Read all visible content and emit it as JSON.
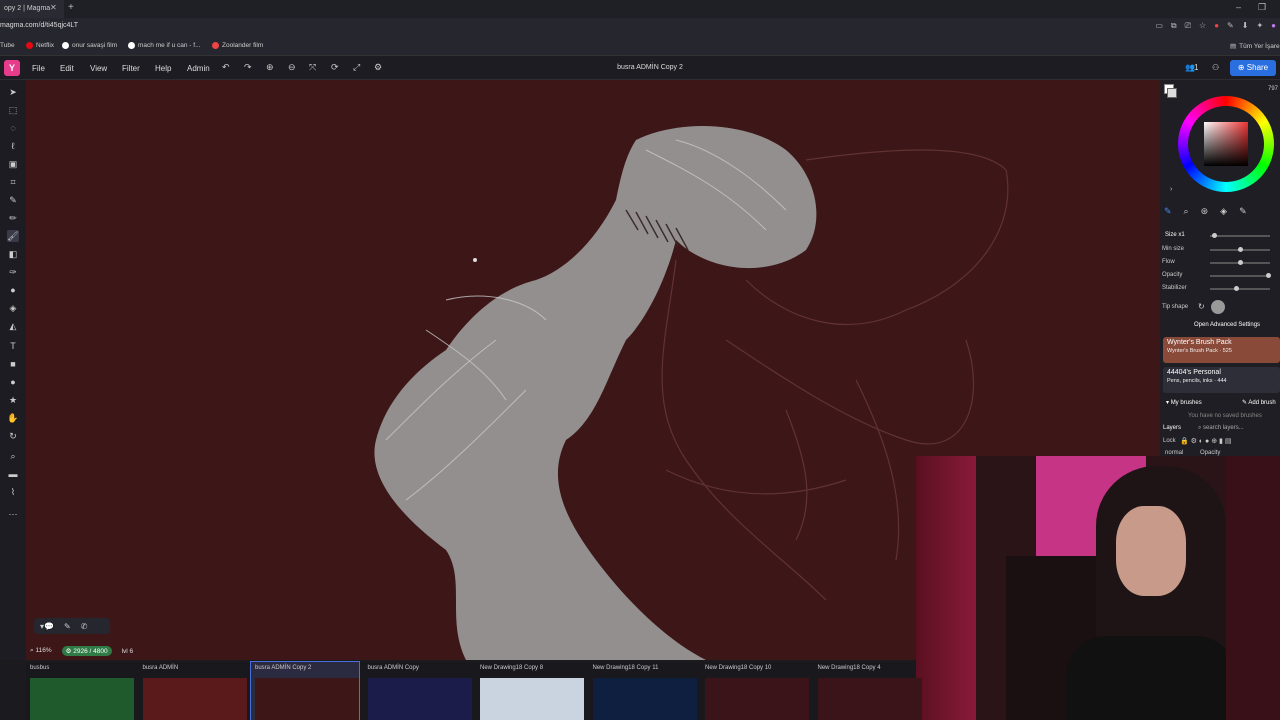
{
  "browser": {
    "tab_title": "opy 2 | Magma",
    "url": "magma.com/d/ti45qjc4LT",
    "bookmarks": [
      {
        "label": "Tube"
      },
      {
        "label": "Netflix"
      },
      {
        "label": "onur savaşi film"
      },
      {
        "label": "mach me if u can - f..."
      },
      {
        "label": "Zoolander film"
      }
    ],
    "all_bookmarks": "Tüm Yer İşare"
  },
  "app": {
    "logo": "Y",
    "menu": [
      "File",
      "Edit",
      "View",
      "Filter",
      "Help",
      "Admin"
    ],
    "document_title": "busra ADMİN Copy 2",
    "collaborators": "1",
    "share_label": "Share"
  },
  "right_panel": {
    "size_label": "Size x1",
    "min_size_label": "Min size",
    "flow_label": "Flow",
    "opacity_label": "Opacity",
    "stabilizer_label": "Stabilizer",
    "tip_shape_label": "Tip shape",
    "advanced_label": "Open Advanced Settings",
    "brush_packs": [
      {
        "title": "Wynter's Brush Pack",
        "sub": "Wynter's Brush Pack · 525"
      },
      {
        "title": "44404's Personal",
        "sub": "Pens, pencils, inks · 444"
      }
    ],
    "my_brushes": "My brushes",
    "add_brush": "Add brush",
    "no_brushes": "You have no saved brushes",
    "layers_label": "Layers",
    "search_layers": "search layers...",
    "lock_label": "Lock",
    "blend_mode": "normal",
    "opacity_small": "Opacity",
    "counter": "797"
  },
  "status": {
    "zoom": "116%",
    "resolution": "2926 / 4800",
    "level": "lvl 6"
  },
  "drawings": [
    {
      "name": "busbus",
      "color": "#1f5a2c"
    },
    {
      "name": "busra ADMİN",
      "color": "#5a1a1c"
    },
    {
      "name": "busra ADMİN Copy 2",
      "color": "#3d1617",
      "selected": true
    },
    {
      "name": "busra ADMİN Copy",
      "color": "#1c1c4a"
    },
    {
      "name": "New Drawing18 Copy 8",
      "color": "#c9d4e0"
    },
    {
      "name": "New Drawing18 Copy 11",
      "color": "#0f1f40"
    },
    {
      "name": "New Drawing18 Copy 10",
      "color": "#3a1418"
    },
    {
      "name": "New Drawing18 Copy 4",
      "color": "#3a1418"
    }
  ]
}
